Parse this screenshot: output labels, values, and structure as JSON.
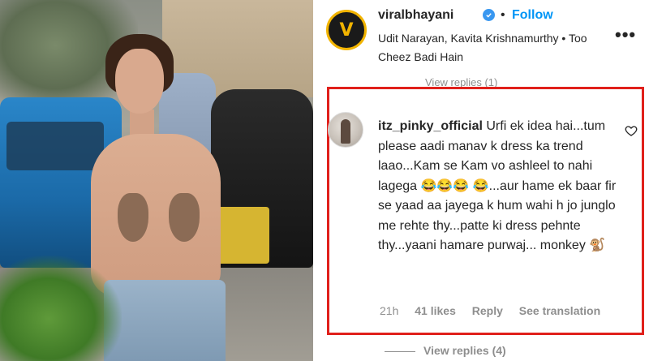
{
  "header": {
    "username": "viralbhayani",
    "follow_label": "Follow",
    "dot": "•",
    "more_label": "•••",
    "audio_line": "Udit Narayan, Kavita Krishnamurthy • Too Cheez Badi Hain",
    "logo_letter": "V"
  },
  "top_replies": "View replies (1)",
  "comment": {
    "username": "itz_pinky_official",
    "text": "Urfi ek idea hai...tum please aadi manav k dress ka trend laao...Kam se Kam vo ashleel to nahi lagega 😂😂😂 😂...aur hame ek baar fir se yaad aa jayega k hum wahi h jo junglo me rehte thy...patte ki dress pehnte thy...yaani hamare purwaj... monkey 🐒",
    "time": "21h",
    "likes": "41 likes",
    "reply_label": "Reply",
    "translate_label": "See translation"
  },
  "bottom_replies": "View replies (4)",
  "colors": {
    "follow": "#0095f6",
    "verified": "#3897f0",
    "highlight_border": "#e0201b",
    "muted": "#8e8e8e"
  },
  "icons": [
    "verified-badge-icon",
    "more-options-icon",
    "heart-icon"
  ]
}
